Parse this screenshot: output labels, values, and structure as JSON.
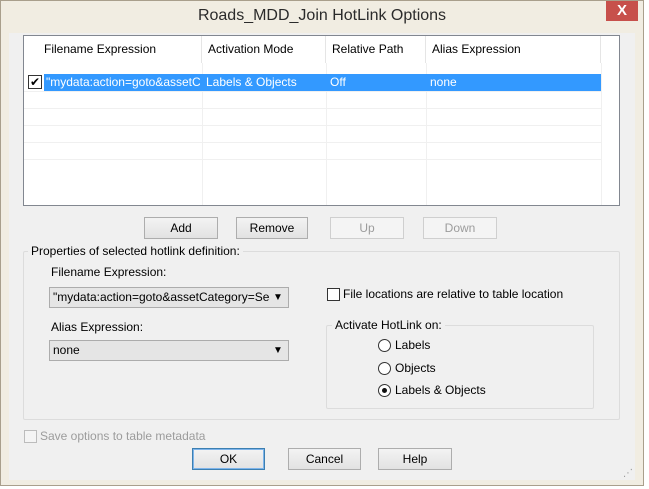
{
  "window": {
    "title": "Roads_MDD_Join HotLink Options",
    "close_glyph": "X"
  },
  "list": {
    "columns": [
      "Filename Expression",
      "Activation Mode",
      "Relative Path",
      "Alias Expression"
    ],
    "rows": [
      {
        "checked": true,
        "cells": [
          "\"mydata:action=goto&assetCa...",
          "Labels & Objects",
          "Off",
          "none"
        ]
      }
    ]
  },
  "list_buttons": {
    "add": "Add",
    "remove": "Remove",
    "up": "Up",
    "down": "Down"
  },
  "properties": {
    "group_label": "Properties of selected hotlink definition:",
    "filename_label": "Filename Expression:",
    "filename_value": "\"mydata:action=goto&assetCategory=SealedR",
    "relative_checkbox_label": "File locations are relative to table location",
    "alias_label": "Alias Expression:",
    "alias_value": "none",
    "activate_group_label": "Activate HotLink on:",
    "radio_options": [
      "Labels",
      "Objects",
      "Labels & Objects"
    ],
    "selected_option": "Labels & Objects"
  },
  "save_option_label": "Save options to table metadata",
  "dialog_buttons": {
    "ok": "OK",
    "cancel": "Cancel",
    "help": "Help"
  }
}
